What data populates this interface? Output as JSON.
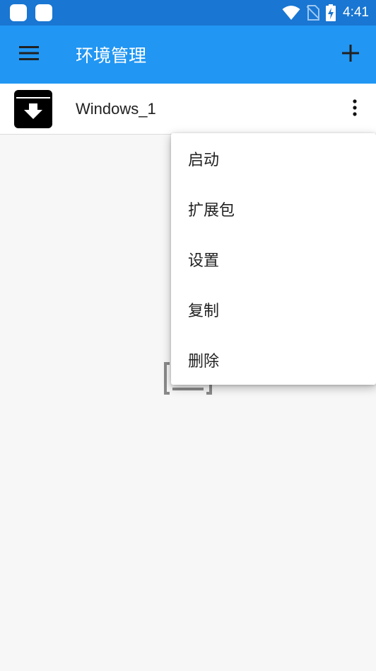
{
  "status_bar": {
    "time": "4:41",
    "notifications": [
      "app-notification-icon",
      "app-notification-icon"
    ],
    "icons": [
      "wifi-icon",
      "no-sim-icon",
      "battery-charging-icon"
    ]
  },
  "app_bar": {
    "title": "环境管理",
    "menu_icon": "hamburger-menu-icon",
    "add_icon": "plus-icon",
    "color": "#2196f3"
  },
  "environments": [
    {
      "name": "Windows_1",
      "icon": "archive-download-icon"
    }
  ],
  "context_menu": {
    "items": [
      {
        "label": "启动"
      },
      {
        "label": "扩展包"
      },
      {
        "label": "设置"
      },
      {
        "label": "复制"
      },
      {
        "label": "删除"
      }
    ]
  }
}
